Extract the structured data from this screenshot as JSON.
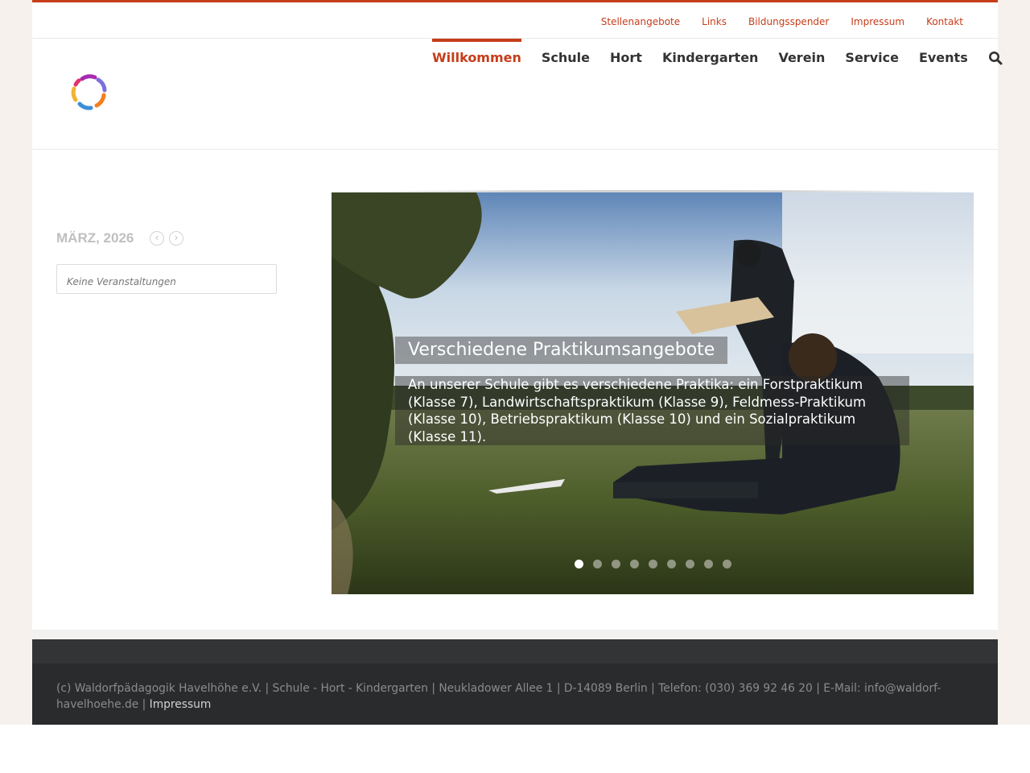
{
  "secondary_nav": [
    "Stellenangebote",
    "Links",
    "Bildungsspender",
    "Impressum",
    "Kontakt"
  ],
  "main_nav": {
    "items": [
      "Willkommen",
      "Schule",
      "Hort",
      "Kindergarten",
      "Verein",
      "Service",
      "Events"
    ],
    "active": "Willkommen"
  },
  "icons": {
    "search": "search-icon",
    "prev": "chevron-left-icon",
    "next": "chevron-right-icon"
  },
  "calendar": {
    "month": "MÄRZ, 2026",
    "prev": "‹",
    "next": "›",
    "no_events": "Keine Veranstaltungen"
  },
  "slider": {
    "title": "Verschiedene Praktikumsangebote",
    "text": "An unserer Schule gibt es verschiedene Praktika: ein Forstpraktikum (Klasse 7), Landwirtschaftspraktikum (Klasse 9), Feldmess-Praktikum (Klasse 10), Betriebspraktikum (Klasse 10) und ein Sozialpraktikum (Klasse 11).",
    "slide_count": 9,
    "active_slide": 1
  },
  "footer": {
    "text": "(c) Waldorfpädagogik Havelhöhe e.V. | Schule - Hort - Kindergarten | Neukladower Allee 1 | D-14089 Berlin | Telefon: (030) 369 92 46 20 | E-Mail: info@waldorf-havelhoehe.de |",
    "link": "Impressum"
  },
  "colors": {
    "accent": "#c63d1a",
    "footer": "#2a2b2d",
    "text": "#333333"
  }
}
